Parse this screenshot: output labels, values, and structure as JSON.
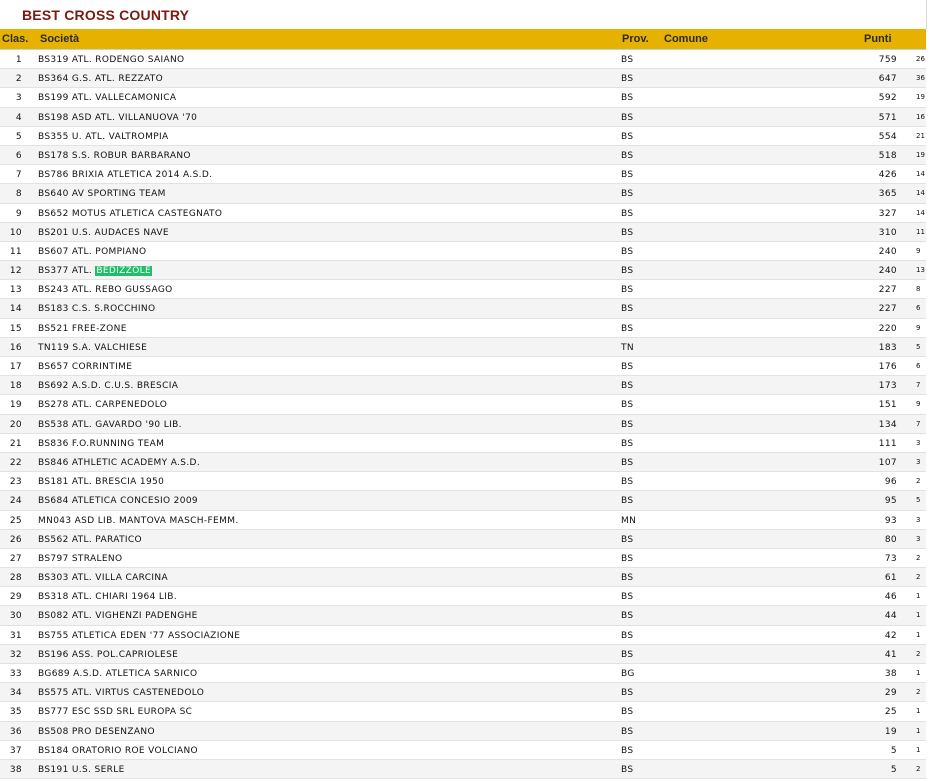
{
  "page": {
    "title": "BEST CROSS COUNTRY"
  },
  "table": {
    "headers": {
      "clas": "Clas.",
      "societa": "Società",
      "prov": "Prov.",
      "comune": "Comune",
      "punti": "Punti"
    },
    "highlight": {
      "row_index": 11,
      "before": "BS377 ATL. ",
      "word": "BEDIZZOLE"
    },
    "rows": [
      {
        "rank": "1",
        "societa": "BS319 ATL. RODENGO SAIANO",
        "prov": "BS",
        "punti": "759",
        "extra": "26"
      },
      {
        "rank": "2",
        "societa": "BS364 G.S. ATL. REZZATO",
        "prov": "BS",
        "punti": "647",
        "extra": "36"
      },
      {
        "rank": "3",
        "societa": "BS199 ATL. VALLECAMONICA",
        "prov": "BS",
        "punti": "592",
        "extra": "19"
      },
      {
        "rank": "4",
        "societa": "BS198 ASD ATL. VILLANUOVA '70",
        "prov": "BS",
        "punti": "571",
        "extra": "16"
      },
      {
        "rank": "5",
        "societa": "BS355 U. ATL. VALTROMPIA",
        "prov": "BS",
        "punti": "554",
        "extra": "21"
      },
      {
        "rank": "6",
        "societa": "BS178 S.S. ROBUR BARBARANO",
        "prov": "BS",
        "punti": "518",
        "extra": "19"
      },
      {
        "rank": "7",
        "societa": "BS786 BRIXIA ATLETICA 2014 A.S.D.",
        "prov": "BS",
        "punti": "426",
        "extra": "14"
      },
      {
        "rank": "8",
        "societa": "BS640 AV SPORTING TEAM",
        "prov": "BS",
        "punti": "365",
        "extra": "14"
      },
      {
        "rank": "9",
        "societa": "BS652 MOTUS ATLETICA CASTEGNATO",
        "prov": "BS",
        "punti": "327",
        "extra": "14"
      },
      {
        "rank": "10",
        "societa": "BS201 U.S. AUDACES NAVE",
        "prov": "BS",
        "punti": "310",
        "extra": "11"
      },
      {
        "rank": "11",
        "societa": "BS607 ATL. POMPIANO",
        "prov": "BS",
        "punti": "240",
        "extra": "9"
      },
      {
        "rank": "12",
        "societa": "BS377 ATL. BEDIZZOLE",
        "prov": "BS",
        "punti": "240",
        "extra": "13"
      },
      {
        "rank": "13",
        "societa": "BS243 ATL. REBO GUSSAGO",
        "prov": "BS",
        "punti": "227",
        "extra": "8"
      },
      {
        "rank": "14",
        "societa": "BS183 C.S. S.ROCCHINO",
        "prov": "BS",
        "punti": "227",
        "extra": "6"
      },
      {
        "rank": "15",
        "societa": "BS521 FREE-ZONE",
        "prov": "BS",
        "punti": "220",
        "extra": "9"
      },
      {
        "rank": "16",
        "societa": "TN119 S.A. VALCHIESE",
        "prov": "TN",
        "punti": "183",
        "extra": "5"
      },
      {
        "rank": "17",
        "societa": "BS657 CORRINTIME",
        "prov": "BS",
        "punti": "176",
        "extra": "6"
      },
      {
        "rank": "18",
        "societa": "BS692 A.S.D. C.U.S. BRESCIA",
        "prov": "BS",
        "punti": "173",
        "extra": "7"
      },
      {
        "rank": "19",
        "societa": "BS278 ATL. CARPENEDOLO",
        "prov": "BS",
        "punti": "151",
        "extra": "9"
      },
      {
        "rank": "20",
        "societa": "BS538 ATL. GAVARDO '90 LIB.",
        "prov": "BS",
        "punti": "134",
        "extra": "7"
      },
      {
        "rank": "21",
        "societa": "BS836 F.O.RUNNING TEAM",
        "prov": "BS",
        "punti": "111",
        "extra": "3"
      },
      {
        "rank": "22",
        "societa": "BS846 ATHLETIC ACADEMY A.S.D.",
        "prov": "BS",
        "punti": "107",
        "extra": "3"
      },
      {
        "rank": "23",
        "societa": "BS181 ATL. BRESCIA 1950",
        "prov": "BS",
        "punti": "96",
        "extra": "2"
      },
      {
        "rank": "24",
        "societa": "BS684 ATLETICA CONCESIO 2009",
        "prov": "BS",
        "punti": "95",
        "extra": "5"
      },
      {
        "rank": "25",
        "societa": "MN043 ASD LIB. MANTOVA MASCH-FEMM.",
        "prov": "MN",
        "punti": "93",
        "extra": "3"
      },
      {
        "rank": "26",
        "societa": "BS562 ATL. PARATICO",
        "prov": "BS",
        "punti": "80",
        "extra": "3"
      },
      {
        "rank": "27",
        "societa": "BS797 STRALENO",
        "prov": "BS",
        "punti": "73",
        "extra": "2"
      },
      {
        "rank": "28",
        "societa": "BS303 ATL. VILLA CARCINA",
        "prov": "BS",
        "punti": "61",
        "extra": "2"
      },
      {
        "rank": "29",
        "societa": "BS318 ATL. CHIARI 1964 LIB.",
        "prov": "BS",
        "punti": "46",
        "extra": "1"
      },
      {
        "rank": "30",
        "societa": "BS082 ATL. VIGHENZI PADENGHE",
        "prov": "BS",
        "punti": "44",
        "extra": "1"
      },
      {
        "rank": "31",
        "societa": "BS755 ATLETICA EDEN '77 ASSOCIAZIONE",
        "prov": "BS",
        "punti": "42",
        "extra": "1"
      },
      {
        "rank": "32",
        "societa": "BS196 ASS. POL.CAPRIOLESE",
        "prov": "BS",
        "punti": "41",
        "extra": "2"
      },
      {
        "rank": "33",
        "societa": "BG689 A.S.D. ATLETICA SARNICO",
        "prov": "BG",
        "punti": "38",
        "extra": "1"
      },
      {
        "rank": "34",
        "societa": "BS575 ATL. VIRTUS CASTENEDOLO",
        "prov": "BS",
        "punti": "29",
        "extra": "2"
      },
      {
        "rank": "35",
        "societa": "BS777 ESC SSD SRL EUROPA SC",
        "prov": "BS",
        "punti": "25",
        "extra": "1"
      },
      {
        "rank": "36",
        "societa": "BS508 PRO DESENZANO",
        "prov": "BS",
        "punti": "19",
        "extra": "1"
      },
      {
        "rank": "37",
        "societa": "BS184 ORATORIO ROE VOLCIANO",
        "prov": "BS",
        "punti": "5",
        "extra": "1"
      },
      {
        "rank": "38",
        "societa": "BS191 U.S. SERLE",
        "prov": "BS",
        "punti": "5",
        "extra": "2"
      }
    ]
  }
}
